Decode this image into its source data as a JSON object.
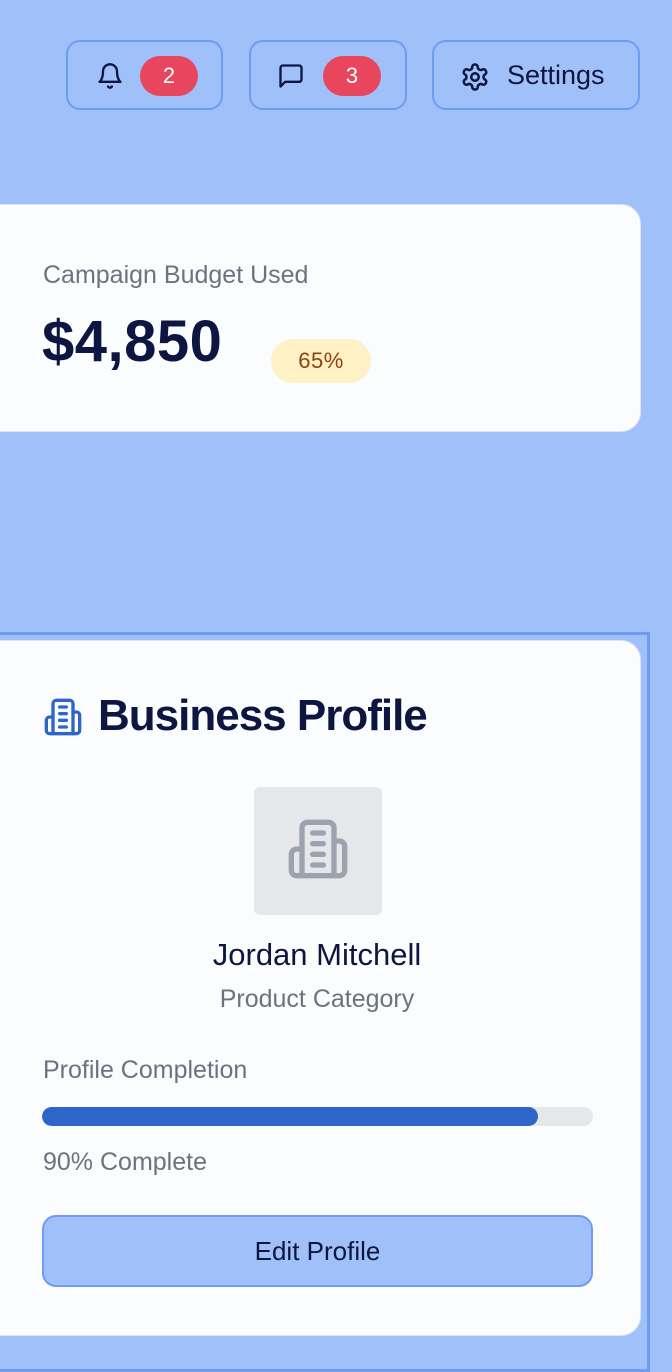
{
  "header": {
    "notifications": {
      "icon": "bell-icon",
      "count": "2"
    },
    "messages": {
      "icon": "message-square-icon",
      "count": "3"
    },
    "settings": {
      "icon": "gear-icon",
      "label": "Settings"
    }
  },
  "budget": {
    "label": "Campaign Budget Used",
    "amount": "$4,850",
    "percent_label": "65%"
  },
  "business_profile": {
    "title": "Business Profile",
    "title_icon": "building-icon",
    "avatar_icon": "building-icon",
    "name": "Jordan Mitchell",
    "category": "Product Category",
    "completion_label": "Profile Completion",
    "completion_value": 0.9,
    "completion_text": "90% Complete",
    "edit_button_label": "Edit Profile"
  },
  "colors": {
    "page_background": "#a0c0fa",
    "card_background": "#fbfcfe",
    "accent_border": "#6f9cf0",
    "badge_red": "#e8465f",
    "progress_blue": "#2d66c8",
    "budget_pill_bg": "#fdf1c5",
    "budget_pill_text": "#92400e",
    "primary_text": "#0d1640",
    "muted_text": "#6b7280"
  }
}
